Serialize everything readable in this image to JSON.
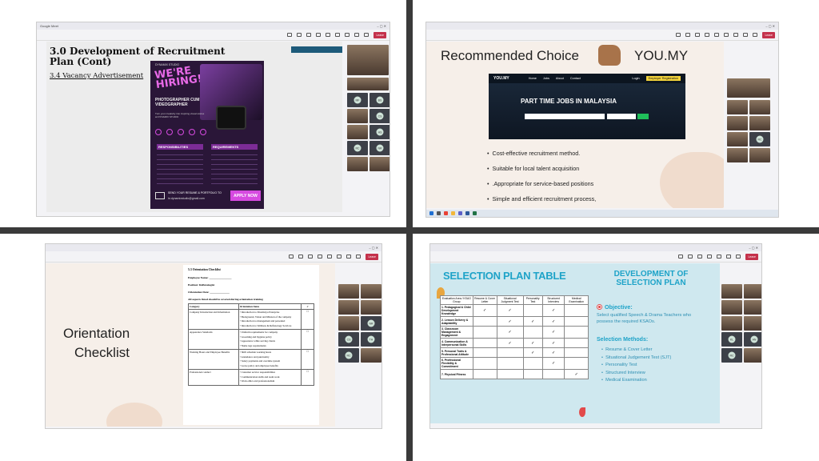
{
  "panel1": {
    "window_title": "Google Meet",
    "slide": {
      "title": "3.0 Development of Recruitment Plan (Cont)",
      "subtitle": "3.4  Vacancy Advertisement",
      "poster": {
        "studio": "DYNAMIX STUDIO",
        "headline": "WE'RE HIRING!",
        "roles": "PHOTOGRAPHER CUM VIDEOGRAPHER",
        "tagline": "Turn your creativity into inspiring visual stories at DYNAMIX STUDIO",
        "responsibilities_title": "RESPONSIBILITIES",
        "requirements_title": "REQUIREMENTS",
        "send_text": "SEND YOUR RESUME & PORTFOLIO TO",
        "email": "hr.dynamixstudio@gmail.com",
        "apply": "APPLY NOW"
      }
    },
    "gallery_initials": [
      "MF",
      "BS",
      "CS",
      "HS",
      "RC",
      "NR"
    ]
  },
  "panel2": {
    "slide": {
      "heading": "Recommended Choice",
      "brand": "YOU.MY",
      "site_nav": [
        "Home",
        "Jobs",
        "About",
        "Contact"
      ],
      "login": "Login",
      "employer": "Employer Registration",
      "hero": "PART TIME JOBS IN MALAYSIA",
      "bullets": [
        "Cost-effective recruitment method.",
        "Suitable for local talent acquisition",
        ".Appropriate for service-based positions",
        "Simple and efficient recruitment process,"
      ]
    },
    "gallery_initials": [
      "RC"
    ]
  },
  "panel3": {
    "slide": {
      "title_line1": "Orientation",
      "title_line2": "Checklist",
      "doc_title": "5.3 Orientation Checklist",
      "fields": [
        "Employee Name: ________________",
        "Position: Reflexologist",
        "Orientation Date: ______________"
      ],
      "note": "All aspects listed should be covered during orientation training",
      "headers": [
        "Category",
        "Orientation Items",
        "✓"
      ],
      "rows": [
        {
          "category": "Company Introduction and Information",
          "items": [
            "Introduction to Zharmaiya Enterprise",
            "Background, Vision and Mission of the company",
            "Introduction to management and personnel",
            "Introduction to Wellness & Reflexology Services"
          ]
        },
        {
          "category": "Appearance Standards",
          "items": [
            "Uniform requirements for company",
            "Grooming and hygiene policy",
            "Appearance while serving clients",
            "Name tags requirements"
          ]
        },
        {
          "category": "Working Hours and Employee Benefits",
          "items": [
            "Shift schedule working hours",
            "Attendance and punctuality",
            "Salary payments and overtime system",
            "Leave policy and employee benefits"
          ]
        },
        {
          "category": "Professional conduct",
          "items": [
            "Customer service responsibilities",
            "Communication skills and team work",
            "Work ethics and professionalism"
          ]
        }
      ]
    },
    "gallery_initials": [
      "NR",
      "CS",
      "TH",
      "RC"
    ]
  },
  "panel4": {
    "slide": {
      "table_title": "SELECTION PLAN TABLE",
      "right_title": "DEVELOPMENT OF SELECTION PLAN",
      "objective_label": "Objective:",
      "objective_text": "Select qualified Speech & Drama Teachers who possess the required KSAOs.",
      "methods_label": "Selection Methods:",
      "methods": [
        "Resume & Cover Letter",
        "Situational Judgement Test (SJT)",
        "Personality Test",
        "Structured Interview",
        "Medical Examination"
      ],
      "headers": [
        "Evaluation Area / KSAO Group",
        "Resume & Cover Letter",
        "Situational Judgment Test",
        "Personality Test",
        "Structured Interview",
        "Medical Examination"
      ],
      "rows": [
        {
          "area": "1. Pedagogical & Child Development Knowledge",
          "marks": [
            true,
            true,
            false,
            true,
            false
          ]
        },
        {
          "area": "2. Lesson Delivery & Adaptability",
          "marks": [
            false,
            true,
            true,
            true,
            false
          ]
        },
        {
          "area": "3. Classroom Management & Engagement",
          "marks": [
            false,
            true,
            false,
            true,
            false
          ]
        },
        {
          "area": "4. Communication & Interpersonal Skills",
          "marks": [
            false,
            true,
            true,
            true,
            false
          ]
        },
        {
          "area": "5. Personal Traits & Professional Attitude",
          "marks": [
            false,
            false,
            true,
            true,
            false
          ]
        },
        {
          "area": "6. Professional Flexibility & Commitment",
          "marks": [
            false,
            false,
            false,
            true,
            false
          ]
        },
        {
          "area": "7. Physical Fitness",
          "marks": [
            false,
            false,
            false,
            false,
            true
          ]
        }
      ]
    },
    "gallery_initials": [
      "KL",
      "AN",
      "RC"
    ]
  },
  "colors": {
    "slide_cream": "#f6efe9",
    "slide_blue": "#cfe8ef",
    "accent_teal": "#1ea3c8",
    "poster_purple": "#2a1638",
    "poster_pink": "#d64ae0",
    "leave_red": "#c4314b",
    "yellow": "#f3d33b"
  }
}
